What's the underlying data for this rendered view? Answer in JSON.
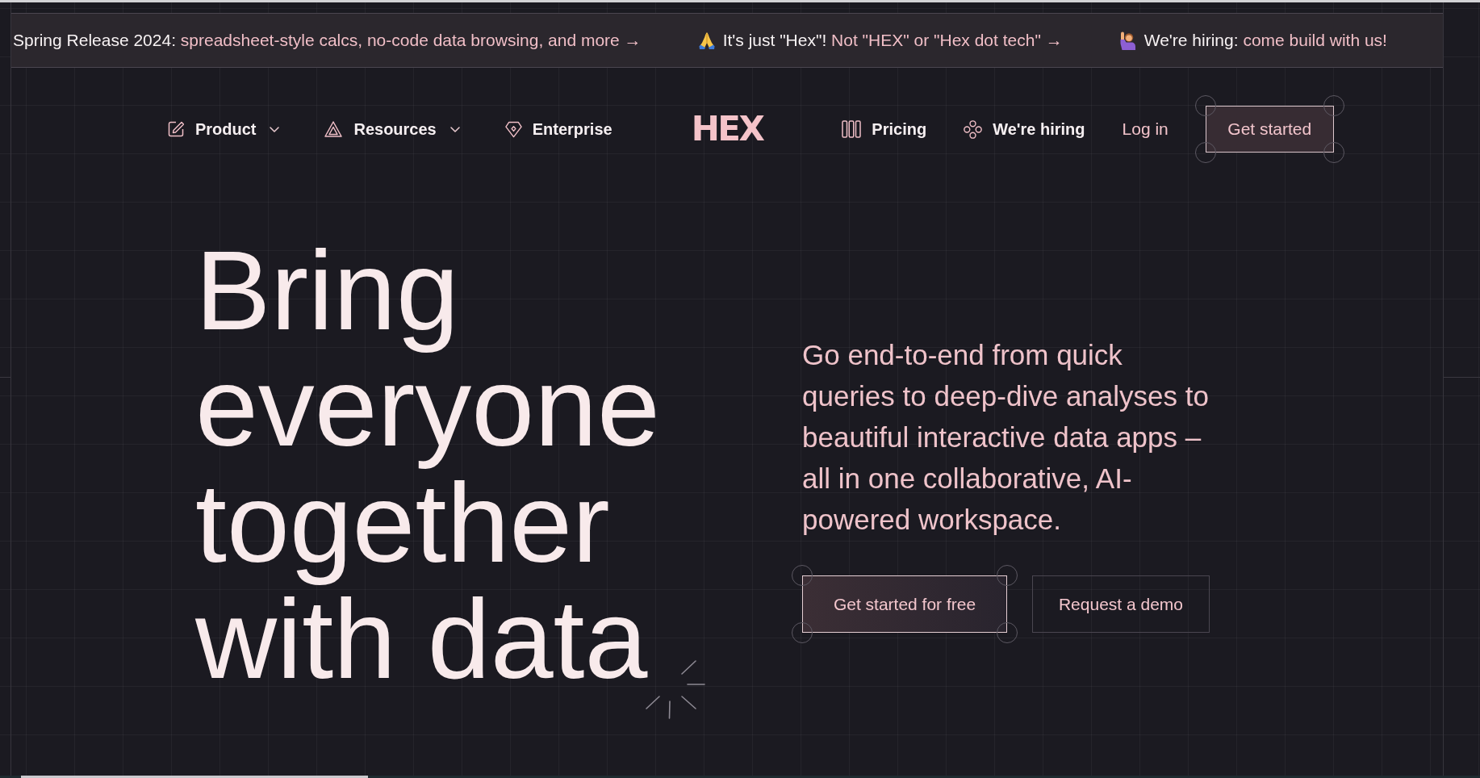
{
  "announcement_bar": {
    "items": [
      {
        "kind": "release",
        "label": "Spring Release 2024:",
        "link": "spreadsheet-style calcs, no-code data browsing, and more →"
      },
      {
        "kind": "name",
        "label": "It's just \"Hex\"!",
        "link": "Not \"HEX\" or \"Hex dot tech\" →"
      },
      {
        "kind": "hiring",
        "label": "We're hiring:",
        "link": "come build with us!"
      }
    ]
  },
  "nav": {
    "left_items": [
      {
        "kind": "menu",
        "label": "Product"
      },
      {
        "kind": "menu",
        "label": "Resources"
      },
      {
        "kind": "link",
        "label": "Enterprise"
      }
    ],
    "logo": "HEX",
    "right_items": [
      {
        "kind": "link",
        "label": "Pricing"
      },
      {
        "kind": "link",
        "label": "We're hiring"
      },
      {
        "kind": "plain",
        "label": "Log in"
      }
    ],
    "cta": "Get started"
  },
  "hero": {
    "headline": "Bring everyone together with data",
    "description": "Go end-to-end from quick queries to deep-dive analyses to beautiful interactive data apps – all in one collaborative, AI-powered workspace.",
    "buttons": [
      {
        "kind": "primary",
        "label": "Get started for free"
      },
      {
        "kind": "secondary",
        "label": "Request a demo"
      }
    ]
  }
}
